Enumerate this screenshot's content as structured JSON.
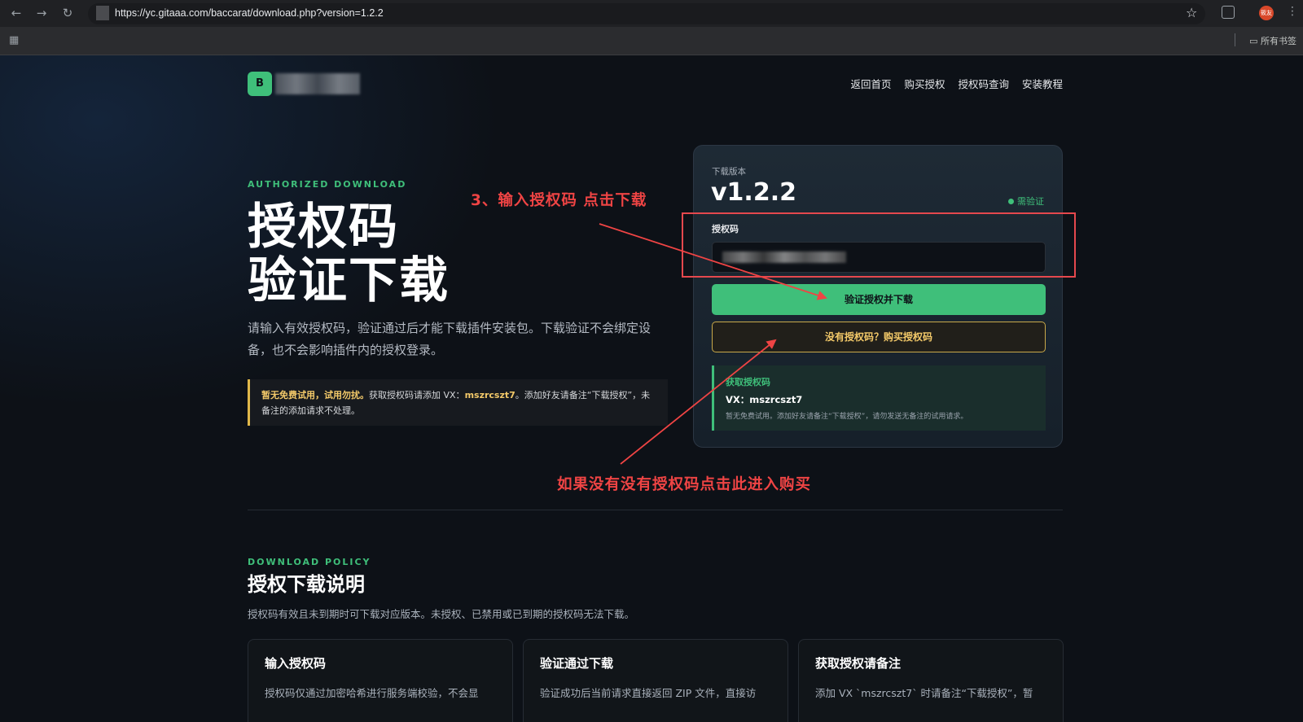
{
  "browser": {
    "url": "https://yc.gitaaa.com/baccarat/download.php?version=1.2.2",
    "bookmarks_label": "所有书签",
    "avatar_text": "筱友"
  },
  "nav": {
    "links": [
      "返回首页",
      "购买授权",
      "授权码查询",
      "安装教程"
    ],
    "logo_letter": "B"
  },
  "hero": {
    "eyebrow": "AUTHORIZED DOWNLOAD",
    "title_line1": "授权码",
    "title_line2": "验证下载",
    "lead": "请输入有效授权码，验证通过后才能下载插件安装包。下载验证不会绑定设备，也不会影响插件内的授权登录。",
    "notice_bold1": "暂无免费试用，试用勿扰。",
    "notice_text1": "获取授权码请添加 VX：",
    "notice_vx": "mszrcszt7",
    "notice_text2": "。添加好友请备注“下载授权”，未备注的添加请求不处理。"
  },
  "card": {
    "version_label": "下载版本",
    "version": "v1.2.2",
    "verify_status": "需验证",
    "code_label": "授权码",
    "primary_button": "验证授权并下载",
    "buy_button": "没有授权码？购买授权码",
    "get_title": "获取授权码",
    "get_vx": "VX：mszrcszt7",
    "get_desc": "暂无免费试用。添加好友请备注“下载授权”，请勿发送无备注的试用请求。"
  },
  "annotations": {
    "step3": "3、输入授权码 点击下载",
    "buy_hint": "如果没有没有授权码点击此进入购买"
  },
  "policy": {
    "eyebrow": "DOWNLOAD POLICY",
    "title": "授权下载说明",
    "subtitle": "授权码有效且未到期时可下载对应版本。未授权、已禁用或已到期的授权码无法下载。",
    "cards": [
      {
        "title": "输入授权码",
        "desc": "授权码仅通过加密哈希进行服务端校验，不会显"
      },
      {
        "title": "验证通过下载",
        "desc": "验证成功后当前请求直接返回 ZIP 文件，直接访"
      },
      {
        "title": "获取授权请备注",
        "desc": "添加 VX `mszrcszt7` 时请备注“下载授权”，暂"
      }
    ]
  },
  "colors": {
    "accent": "#3fbf7a",
    "warning": "#e0b84a",
    "annotation": "#ef4444",
    "background": "#0d1117"
  }
}
